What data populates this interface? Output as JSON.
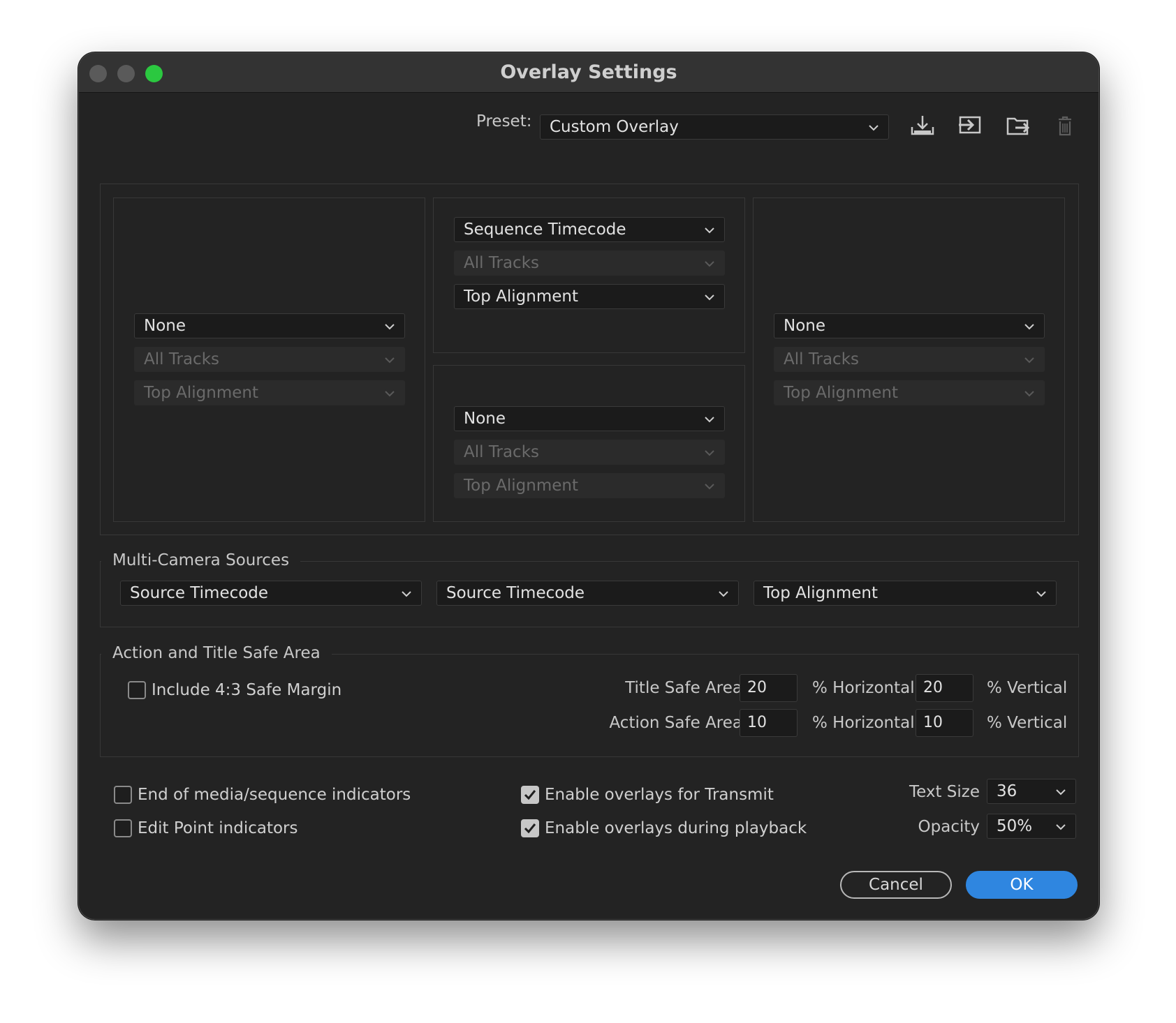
{
  "window": {
    "title": "Overlay Settings"
  },
  "preset": {
    "label": "Preset:",
    "value": "Custom Overlay",
    "icons": [
      "import-preset-icon",
      "export-preset-icon",
      "save-preset-icon",
      "delete-preset-icon"
    ]
  },
  "overlay_positions": {
    "left": {
      "source": "None",
      "tracks": "All Tracks",
      "alignment": "Top Alignment"
    },
    "top_center": {
      "source": "Sequence Timecode",
      "tracks": "All Tracks",
      "alignment": "Top Alignment"
    },
    "bottom_center": {
      "source": "None",
      "tracks": "All Tracks",
      "alignment": "Top Alignment"
    },
    "right": {
      "source": "None",
      "tracks": "All Tracks",
      "alignment": "Top Alignment"
    }
  },
  "multicam": {
    "title": "Multi-Camera Sources",
    "select1": "Source Timecode",
    "select2": "Source Timecode",
    "select3": "Top Alignment"
  },
  "safe_area": {
    "title": "Action and Title Safe Area",
    "include_margin_label": "Include 4:3 Safe Margin",
    "include_margin_checked": false,
    "title_safe_label": "Title Safe Area",
    "title_h": "20",
    "title_v": "20",
    "action_safe_label": "Action Safe Area",
    "action_h": "10",
    "action_v": "10",
    "horizontal_label": "% Horizontal",
    "vertical_label": "% Vertical"
  },
  "options": {
    "end_of_media_label": "End of media/sequence indicators",
    "end_of_media_checked": false,
    "edit_point_label": "Edit Point indicators",
    "edit_point_checked": false,
    "enable_transmit_label": "Enable overlays for Transmit",
    "enable_transmit_checked": true,
    "enable_playback_label": "Enable overlays during playback",
    "enable_playback_checked": true,
    "text_size_label": "Text Size",
    "text_size_value": "36",
    "opacity_label": "Opacity",
    "opacity_value": "50%"
  },
  "buttons": {
    "cancel": "Cancel",
    "ok": "OK"
  },
  "colors": {
    "accent": "#2f86e0",
    "window_bg": "#232323",
    "close_light": "#2bc840"
  }
}
